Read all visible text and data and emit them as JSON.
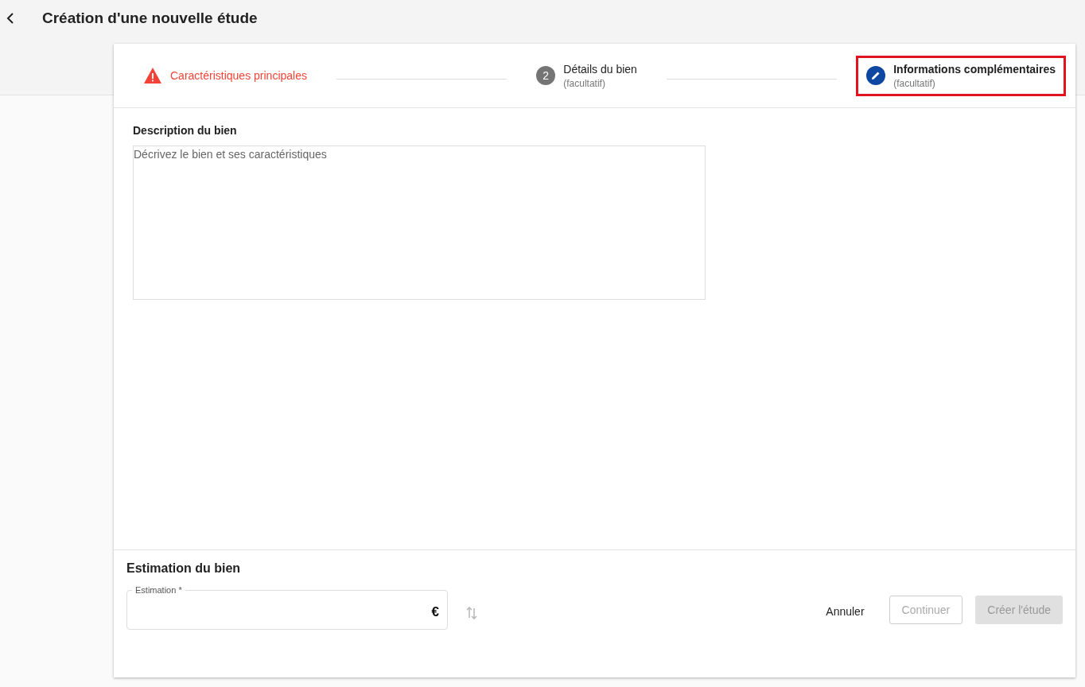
{
  "header": {
    "title": "Création d'une nouvelle étude"
  },
  "steps": [
    {
      "kind": "error",
      "label": "Caractéristiques principales",
      "selected": false,
      "highlighted": false
    },
    {
      "kind": "number",
      "number": "2",
      "label": "Détails du bien",
      "sublabel": "(facultatif)",
      "selected": false,
      "highlighted": false
    },
    {
      "kind": "edit",
      "label": "Informations complémentaires",
      "sublabel": "(facultatif)",
      "selected": true,
      "highlighted": true
    }
  ],
  "description": {
    "label": "Description du bien",
    "placeholder": "Décrivez le bien et ses caractéristiques"
  },
  "estimation": {
    "title": "Estimation du bien",
    "field_label": "Estimation *",
    "suffix": "€"
  },
  "buttons": [
    {
      "kind": "text",
      "label": "Annuler",
      "disabled": false
    },
    {
      "kind": "outlined",
      "label": "Continuer",
      "disabled": true
    },
    {
      "kind": "filled",
      "label": "Créer l'étude",
      "disabled": true
    }
  ]
}
